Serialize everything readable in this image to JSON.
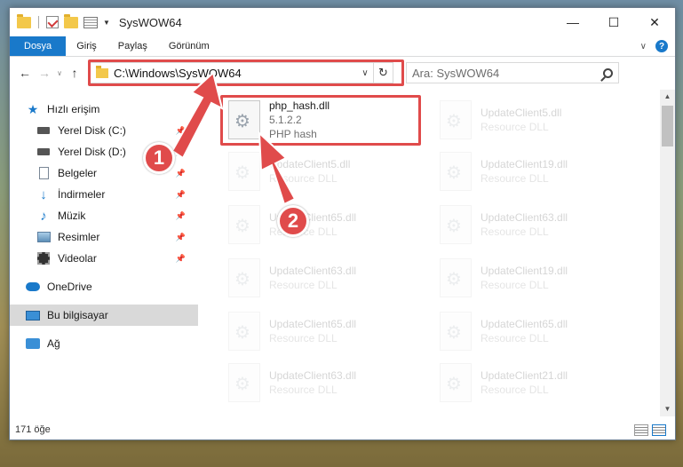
{
  "window": {
    "title": "SysWOW64"
  },
  "titlebar": {
    "minimize_glyph": "—",
    "maximize_glyph": "☐",
    "close_glyph": "✕"
  },
  "ribbon": {
    "tabs": [
      "Dosya",
      "Giriş",
      "Paylaş",
      "Görünüm"
    ],
    "help": "?"
  },
  "nav": {
    "back": "←",
    "forward": "→",
    "up": "↑",
    "address": "C:\\Windows\\SysWOW64",
    "refresh": "↻",
    "search_placeholder": "Ara: SysWOW64"
  },
  "sidebar": {
    "items": [
      {
        "label": "Hızlı erişim",
        "icon": "star-icon"
      },
      {
        "label": "Yerel Disk (C:)",
        "icon": "drive-icon",
        "pinned": true
      },
      {
        "label": "Yerel Disk (D:)",
        "icon": "drive-icon",
        "pinned": true
      },
      {
        "label": "Belgeler",
        "icon": "documents-icon",
        "pinned": true
      },
      {
        "label": "İndirmeler",
        "icon": "download-icon",
        "pinned": true
      },
      {
        "label": "Müzik",
        "icon": "music-icon",
        "pinned": true
      },
      {
        "label": "Resimler",
        "icon": "pictures-icon",
        "pinned": true
      },
      {
        "label": "Videolar",
        "icon": "video-icon",
        "pinned": true
      },
      {
        "label": "OneDrive",
        "icon": "cloud-icon"
      },
      {
        "label": "Bu bilgisayar",
        "icon": "computer-icon",
        "selected": true
      },
      {
        "label": "Ağ",
        "icon": "network-icon"
      }
    ]
  },
  "files": [
    {
      "name": "php_hash.dll",
      "line2": "5.1.2.2",
      "line3": "PHP hash",
      "highlighted": true
    },
    {
      "name": "UpdateClient5.dll",
      "line2": "Resource DLL"
    },
    {
      "name": "UpdateClient5.dll",
      "line2": "Resource DLL"
    },
    {
      "name": "UpdateClient19.dll",
      "line2": "Resource DLL"
    },
    {
      "name": "UpdateClient65.dll",
      "line2": "Resource DLL"
    },
    {
      "name": "UpdateClient63.dll",
      "line2": "Resource DLL"
    },
    {
      "name": "UpdateClient63.dll",
      "line2": "Resource DLL"
    },
    {
      "name": "UpdateClient19.dll",
      "line2": "Resource DLL"
    },
    {
      "name": "UpdateClient65.dll",
      "line2": "Resource DLL"
    },
    {
      "name": "UpdateClient65.dll",
      "line2": "Resource DLL"
    },
    {
      "name": "UpdateClient63.dll",
      "line2": "Resource DLL"
    },
    {
      "name": "UpdateClient21.dll",
      "line2": "Resource DLL"
    }
  ],
  "status": {
    "count": "171 öğe"
  },
  "callouts": [
    "1",
    "2"
  ],
  "colors": {
    "accent": "#1979ca",
    "highlight": "#e04b4b"
  }
}
